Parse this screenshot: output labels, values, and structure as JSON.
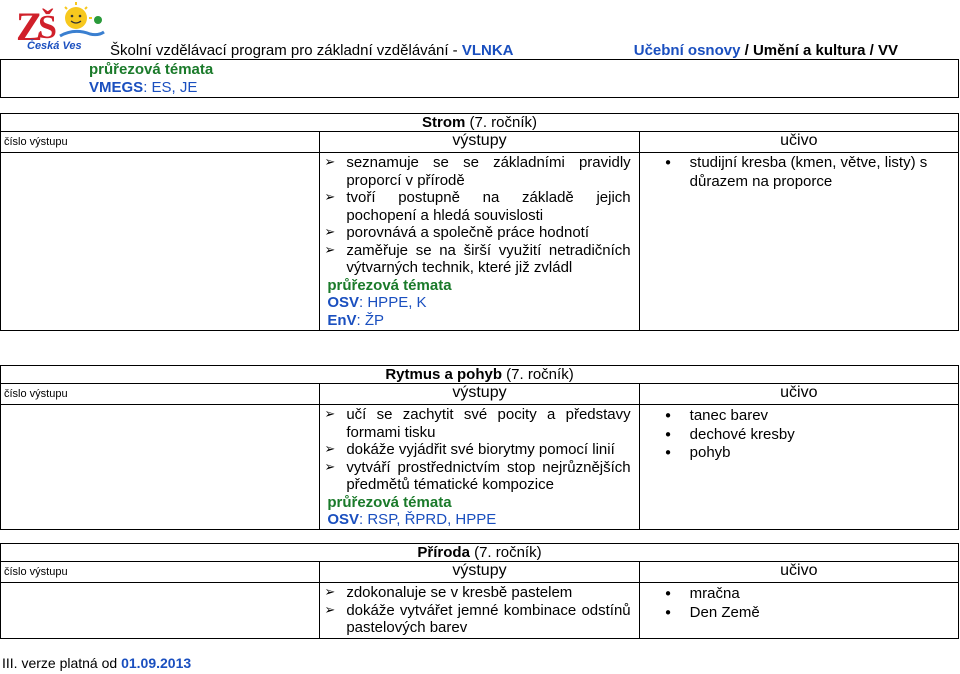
{
  "header": {
    "logo_text": "Česká Ves",
    "program_prefix": "Školní vzdělávací program pro základní vzdělávání - ",
    "program_brand": "VLNKA",
    "osnovy_label": "Učební osnovy",
    "osnovy_rest": " / Umění a kultura / VV"
  },
  "top_block": {
    "pt_label": "průřezová témata",
    "pt_value": "VMEGS: ES, JE"
  },
  "sections": [
    {
      "title": "Strom",
      "year": "(7. ročník)",
      "col_num": "číslo výstupu",
      "col_vystupy": "výstupy",
      "col_ucivo": "učivo",
      "outputs": [
        "seznamuje se se základními pravidly proporcí v přírodě",
        "tvoří postupně na základě jejich pochopení a hledá souvislosti",
        "porovnává a společně práce hodnotí",
        "zaměřuje se na širší využití netradičních výtvarných technik, které již zvládl"
      ],
      "pt_label": "průřezová témata",
      "pt_lines": [
        "OSV: HPPE, K",
        "EnV: ŽP"
      ],
      "ucivo": [
        "studijní kresba (kmen, větve, listy) s důrazem na proporce"
      ]
    },
    {
      "title": "Rytmus a pohyb",
      "year": "(7. ročník)",
      "col_num": "číslo výstupu",
      "col_vystupy": "výstupy",
      "col_ucivo": "učivo",
      "outputs": [
        "učí se zachytit své pocity a představy formami tisku",
        "dokáže vyjádřit své biorytmy pomocí linií",
        "vytváří prostřednictvím stop nejrůznějších předmětů tématické kompozice"
      ],
      "pt_label": "průřezová témata",
      "pt_lines": [
        "OSV: RSP, ŘPRD, HPPE"
      ],
      "ucivo": [
        "tanec barev",
        "dechové kresby",
        "pohyb"
      ]
    },
    {
      "title": "Příroda",
      "year": "(7. ročník)",
      "col_num": "číslo výstupu",
      "col_vystupy": "výstupy",
      "col_ucivo": "učivo",
      "outputs": [
        "zdokonaluje se v kresbě pastelem",
        "dokáže vytvářet jemné kombinace odstínů pastelových barev"
      ],
      "ucivo": [
        "mračna",
        "Den Země"
      ]
    }
  ],
  "footer": {
    "prefix": "III. verze platná od ",
    "date": "01.09.2013"
  }
}
